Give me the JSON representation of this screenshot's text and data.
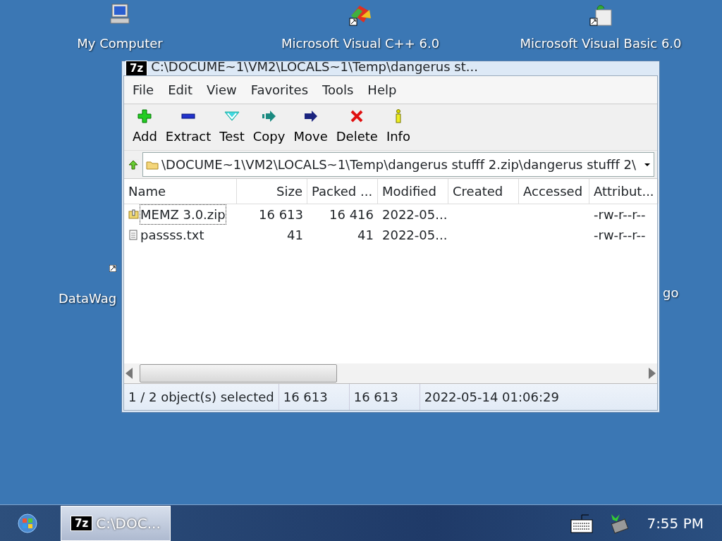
{
  "desktop_icons": [
    {
      "label": "My Computer",
      "kind": "computer"
    },
    {
      "label": "Microsoft Visual C++ 6.0",
      "kind": "vcpp"
    },
    {
      "label": "Microsoft Visual Basic 6.0",
      "kind": "vb"
    },
    {
      "label": "DataWag",
      "kind": "partial-left"
    },
    {
      "label": "go",
      "kind": "partial-right"
    }
  ],
  "window": {
    "logo": "7z",
    "title": "C:\\DOCUME~1\\VM2\\LOCALS~1\\Temp\\dangerus st...",
    "menu": [
      "File",
      "Edit",
      "View",
      "Favorites",
      "Tools",
      "Help"
    ],
    "toolbar": [
      {
        "label": "Add",
        "kind": "add"
      },
      {
        "label": "Extract",
        "kind": "extract"
      },
      {
        "label": "Test",
        "kind": "test"
      },
      {
        "label": "Copy",
        "kind": "copy"
      },
      {
        "label": "Move",
        "kind": "move"
      },
      {
        "label": "Delete",
        "kind": "delete"
      },
      {
        "label": "Info",
        "kind": "info"
      }
    ],
    "address": "\\DOCUME~1\\VM2\\LOCALS~1\\Temp\\dangerus stufff 2.zip\\dangerus stufff 2\\",
    "columns": [
      "Name",
      "Size",
      "Packed ...",
      "Modified",
      "Created",
      "Accessed",
      "Attribut..."
    ],
    "rows": [
      {
        "kind": "archive",
        "selected": true,
        "cells": [
          "MEMZ 3.0.zip",
          "16 613",
          "16 416",
          "2022-05...",
          "",
          "",
          "-rw-r--r--"
        ]
      },
      {
        "kind": "text",
        "selected": false,
        "cells": [
          "passss.txt",
          "41",
          "41",
          "2022-05...",
          "",
          "",
          "-rw-r--r--"
        ]
      }
    ],
    "status_bar": [
      "1 / 2 object(s) selected",
      "16 613",
      "16 613",
      "2022-05-14 01:06:29"
    ]
  },
  "taskbar": {
    "button": {
      "logo": "7z",
      "label": "C:\\DOC..."
    },
    "clock": "7:55 PM"
  }
}
